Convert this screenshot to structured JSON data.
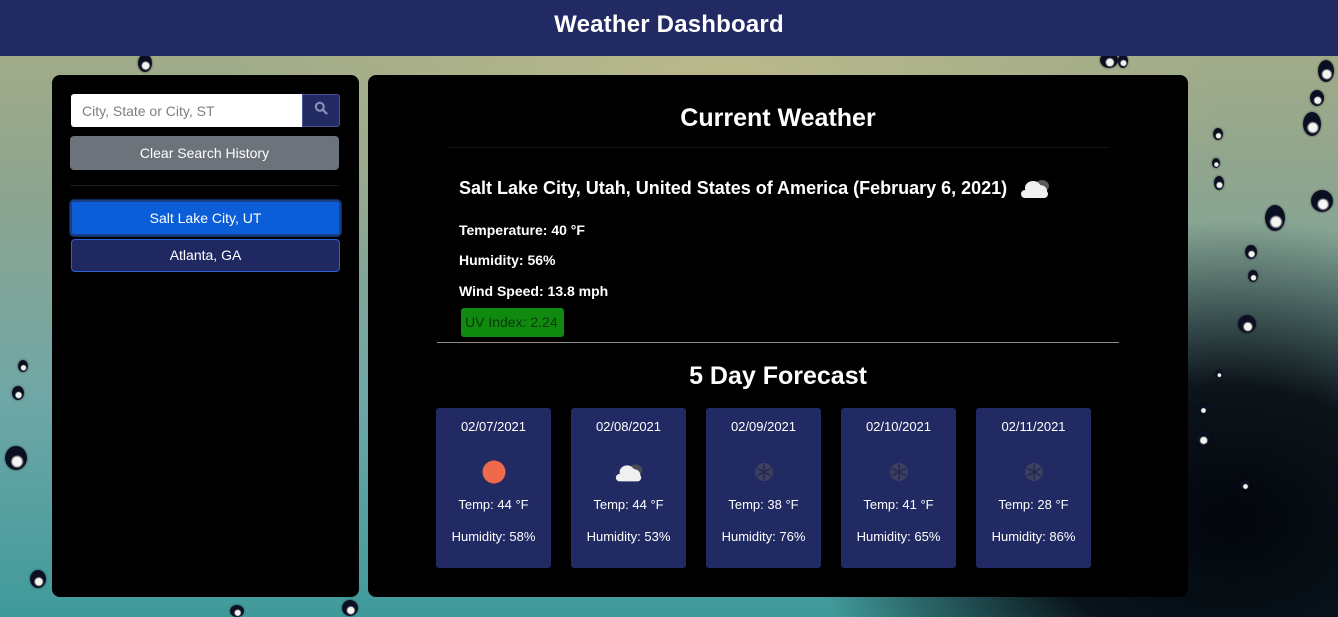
{
  "header": {
    "title": "Weather Dashboard"
  },
  "sidebar": {
    "search": {
      "placeholder": "City, State or City, ST",
      "value": "",
      "button_icon": "search-icon"
    },
    "clear_label": "Clear Search History",
    "history": [
      {
        "label": "Salt Lake City, UT",
        "active": true
      },
      {
        "label": "Atlanta, GA",
        "active": false
      }
    ]
  },
  "current": {
    "heading": "Current Weather",
    "location_line": "Salt Lake City, Utah, United States of America (February 6, 2021)",
    "icon": "cloudy-icon",
    "temperature": "Temperature: 40 °F",
    "humidity": "Humidity: 56%",
    "wind": "Wind Speed: 13.8 mph",
    "uv": "UV Index: 2.24",
    "uv_color": "#0f8a0f"
  },
  "forecast": {
    "heading": "5 Day Forecast",
    "days": [
      {
        "date": "02/07/2021",
        "icon": "sun-icon",
        "temp": "Temp: 44 °F",
        "humidity": "Humidity: 58%"
      },
      {
        "date": "02/08/2021",
        "icon": "cloudy-icon",
        "temp": "Temp: 44 °F",
        "humidity": "Humidity: 53%"
      },
      {
        "date": "02/09/2021",
        "icon": "snow-icon",
        "temp": "Temp: 38 °F",
        "humidity": "Humidity: 76%"
      },
      {
        "date": "02/10/2021",
        "icon": "snow-icon",
        "temp": "Temp: 41 °F",
        "humidity": "Humidity: 65%"
      },
      {
        "date": "02/11/2021",
        "icon": "snow-icon",
        "temp": "Temp: 28 °F",
        "humidity": "Humidity: 86%"
      }
    ]
  },
  "colors": {
    "header_bg": "#212a62",
    "card_bg": "#212a62",
    "active_history": "#0b5ed7",
    "clear_button": "#6c737b",
    "sun": "#ee6a4a"
  }
}
